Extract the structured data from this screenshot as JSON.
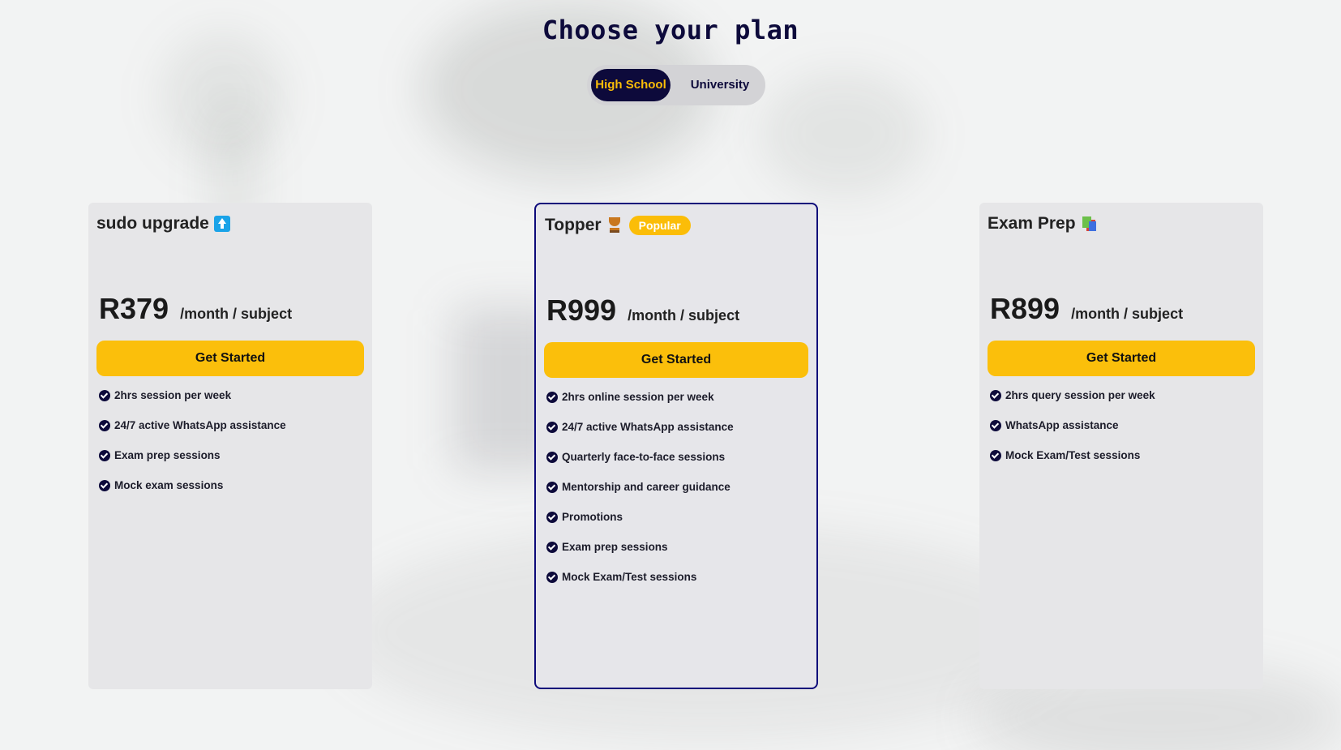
{
  "header": {
    "title": "Choose your plan"
  },
  "toggle": {
    "options": [
      "High School",
      "University"
    ],
    "selected": "High School"
  },
  "plans": [
    {
      "name": "sudo upgrade",
      "icon": "up-arrow-icon",
      "price": "R379",
      "unit": "/month / subject",
      "cta": "Get Started",
      "features": [
        "2hrs session per week",
        "24/7 active WhatsApp assistance",
        "Exam prep sessions",
        "Mock exam sessions"
      ]
    },
    {
      "name": "Topper",
      "icon": "trophy-icon",
      "badge": "Popular",
      "price": "R999",
      "unit": "/month / subject",
      "cta": "Get Started",
      "features": [
        "2hrs online session per week",
        "24/7 active WhatsApp assistance",
        "Quarterly face-to-face sessions",
        "Mentorship and career guidance",
        "Promotions",
        "Exam prep sessions",
        "Mock Exam/Test sessions"
      ]
    },
    {
      "name": "Exam Prep",
      "icon": "books-icon",
      "price": "R899",
      "unit": "/month / subject",
      "cta": "Get Started",
      "features": [
        "2hrs query session per week",
        "WhatsApp assistance",
        "Mock Exam/Test sessions"
      ]
    }
  ],
  "colors": {
    "navy": "#0d0a3b",
    "accent": "#fbbf0b",
    "card": "#e6e6e8",
    "highlight_border": "#0d0a7a"
  }
}
